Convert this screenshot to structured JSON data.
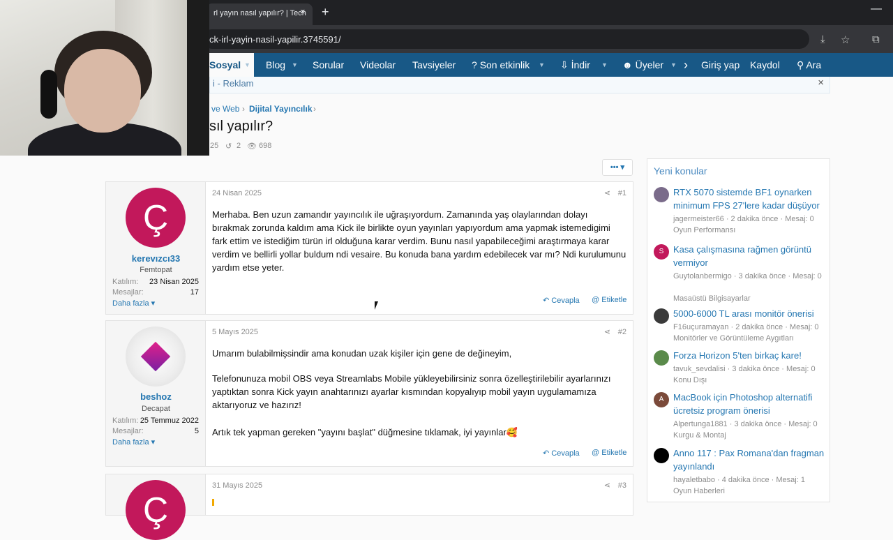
{
  "browser": {
    "tab_title": "rl yayın nasıl yapılır? | Tech",
    "url": "ck-irl-yayin-nasil-yapilir.3745591/",
    "icons": {
      "close": "×",
      "new_tab": "+",
      "minimize": "—",
      "install": "⤓",
      "star": "☆",
      "extensions": "⧉"
    }
  },
  "nav": {
    "items": [
      {
        "label": "Sosyal",
        "selected": true
      },
      {
        "label": "Blog"
      },
      {
        "label": "Sorular"
      },
      {
        "label": "Videolar"
      },
      {
        "label": "Tavsiyeler"
      },
      {
        "label": "Son etkinlik",
        "icon": "?"
      },
      {
        "label": "İndir",
        "icon": "⇩"
      },
      {
        "label": "Üyeler",
        "icon": "☻"
      }
    ],
    "right": {
      "login": "Giriş yap",
      "register": "Kaydol",
      "search": "Ara"
    },
    "arrow": "›"
  },
  "ad": {
    "text": "i - Reklam",
    "close": "×"
  },
  "breadcrumb": {
    "parent": "ve Web",
    "current": "Dijital Yayıncılık",
    "sep": "›"
  },
  "thread": {
    "title": "sıl yapılır?",
    "meta_date": "25",
    "replies": "2",
    "views": "698",
    "more": "•••"
  },
  "posts": [
    {
      "date": "24 Nisan 2025",
      "num": "#1",
      "avatar_letter": "Ç",
      "username": "kerevızcı33",
      "usertitle": "Femtopat",
      "joined_label": "Katılım:",
      "joined": "23 Nisan 2025",
      "msgs_label": "Mesajlar:",
      "msgs": "17",
      "more": "Daha fazla",
      "body": "Merhaba. Ben uzun zamandır yayıncılık ile uğraşıyordum. Zamanında yaş olaylarından dolayı bırakmak zorunda kaldım ama Kick ile birlikte oyun yayınları yapıyordum ama yapmak istemedigimi fark ettim ve istediğim türün irl olduğuna karar verdim. Bunu nasıl yapabileceğimi araştırmaya karar verdim ve bellirli yollar buldum ndi vesaire. Bu konuda bana yardım edebilecek var mı? Ndi kurulumunu yardım etse yeter.",
      "reply": "Cevapla",
      "tag": "Etiketle"
    },
    {
      "date": "5 Mayıs 2025",
      "num": "#2",
      "username": "beshoz",
      "usertitle": "Decapat",
      "joined_label": "Katılım:",
      "joined": "25 Temmuz 2022",
      "msgs_label": "Mesajlar:",
      "msgs": "5",
      "more": "Daha fazla",
      "body_p1": "Umarım bulabilmişsindir ama konudan uzak kişiler için gene de değineyim,",
      "body_p2": "Telefonunuza mobil OBS veya Streamlabs Mobile yükleyebilirsiniz sonra özelleştirilebilir ayarlarınızı yaptıktan sonra Kick yayın anahtarınızı ayarlar kısmından kopyalıyıp mobil yayın uygulamamıza aktarıyoruz ve hazırız!",
      "body_p3": "Artık tek yapman gereken \"yayını başlat\" düğmesine tıklamak, iyi yayınlar🥰",
      "reply": "Cevapla",
      "tag": "Etiketle"
    },
    {
      "date": "31 Mayıs 2025",
      "num": "#3",
      "avatar_letter": "Ç"
    }
  ],
  "sidebar": {
    "heading": "Yeni konular",
    "items": [
      {
        "title": "RTX 5070 sistemde BF1 oynarken minimum FPS 27'lere kadar düşüyor",
        "meta": "jagermeister66 · 2 dakika önce · Mesaj: 0",
        "forum": "Oyun Performansı",
        "avatar": "",
        "color": "#7a6b8a"
      },
      {
        "title": "Kasa çalışmasına rağmen görüntü vermiyor",
        "meta": "Guytolanbermigo · 3 dakika önce · Mesaj: 0",
        "forum": "Masaüstü Bilgisayarlar",
        "avatar": "S",
        "color": "#c2185b"
      },
      {
        "title": "5000-6000 TL arası monitör önerisi",
        "meta": "F16uçuramayan · 2 dakika önce · Mesaj: 0",
        "forum": "Monitörler ve Görüntüleme Aygıtları",
        "avatar": "",
        "color": "#3a3a3a"
      },
      {
        "title": "Forza Horizon 5'ten birkaç kare!",
        "meta": "tavuk_sevdalisi · 3 dakika önce · Mesaj: 0",
        "forum": "Konu Dışı",
        "avatar": "",
        "color": "#5a8a4a"
      },
      {
        "title": "MacBook için Photoshop alternatifi ücretsiz program önerisi",
        "meta": "Alpertunga1881 · 3 dakika önce · Mesaj: 0",
        "forum": "Kurgu & Montaj",
        "avatar": "A",
        "color": "#7b4a3a"
      },
      {
        "title": "Anno 117 : Pax Romana'dan fragman yayınlandı",
        "meta": "hayaletbabo · 4 dakika önce · Mesaj: 1",
        "forum": "Oyun Haberleri",
        "avatar": "",
        "color": "#000000"
      }
    ]
  }
}
